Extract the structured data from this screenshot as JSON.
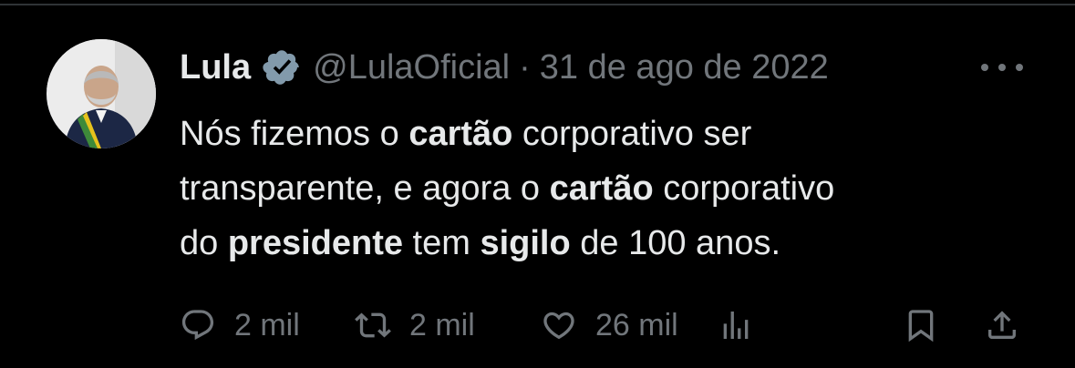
{
  "tweet": {
    "author_name": "Lula",
    "handle": "@LulaOficial",
    "separator": "·",
    "date": "31 de ago de 2022",
    "text_parts": [
      {
        "t": "Nós fizemos o ",
        "b": false
      },
      {
        "t": "cartão",
        "b": true
      },
      {
        "t": " corporativo ser\ntransparente, e agora o ",
        "b": false
      },
      {
        "t": "cartão",
        "b": true
      },
      {
        "t": " corporativo\ndo ",
        "b": false
      },
      {
        "t": "presidente",
        "b": true
      },
      {
        "t": " tem ",
        "b": false
      },
      {
        "t": "sigilo",
        "b": true
      },
      {
        "t": " de 100 anos.",
        "b": false
      }
    ]
  },
  "actions": {
    "replies": "2 mil",
    "retweets": "2 mil",
    "likes": "26 mil"
  },
  "icons": {
    "verified": "verified-badge-icon",
    "more": "more-dots-icon",
    "reply": "reply-icon",
    "retweet": "retweet-icon",
    "like": "heart-icon",
    "views": "views-bar-chart-icon",
    "bookmark": "bookmark-icon",
    "share": "share-icon"
  },
  "colors": {
    "background": "#000000",
    "text": "#e7e9ea",
    "muted": "#71767b",
    "badge": "#829aab",
    "divider": "#2f3336"
  }
}
